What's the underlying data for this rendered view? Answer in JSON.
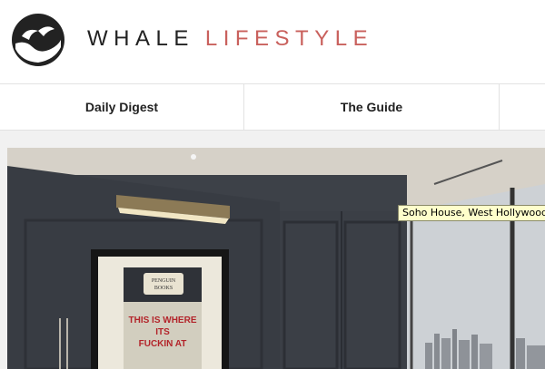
{
  "header": {
    "logo_icon": "whale-tail-logo-icon",
    "brand_word1": "WHALE",
    "brand_word2": "LIFESTYLE",
    "brand_accent_color": "#c9615d"
  },
  "nav": {
    "items": [
      {
        "label": "Daily Digest"
      },
      {
        "label": "The Guide"
      },
      {
        "label": ""
      }
    ]
  },
  "hero": {
    "tooltip": "Soho House, West Hollywood",
    "poster": {
      "publisher_line1": "PENGUIN",
      "publisher_line2": "BOOKS",
      "line1": "THIS IS WHERE",
      "line2": "ITS",
      "line3": "FUCKIN AT"
    }
  }
}
